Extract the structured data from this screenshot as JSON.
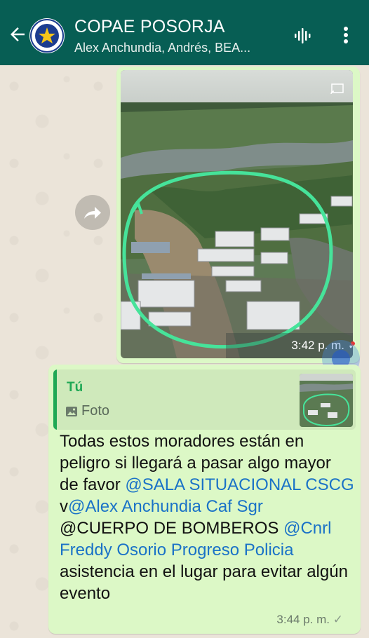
{
  "header": {
    "title": "COPAE POSORJA",
    "subtitle": "Alex Anchundia, Andrés, BEA...",
    "bg_color": "#075e54"
  },
  "image_message": {
    "time": "3:42 p. m.",
    "tick": "✓",
    "photo_description_icon": "cast-icon"
  },
  "text_message": {
    "quote": {
      "author": "Tú",
      "label": "Foto"
    },
    "segments": [
      {
        "text": "Todas estos moradores están en peligro si llegará a pasar algo mayor de favor ",
        "mention": false
      },
      {
        "text": "@SALA SITUACIONAL CSCG",
        "mention": true
      },
      {
        "text": " v",
        "mention": false
      },
      {
        "text": "@Alex Anchundia Caf Sgr",
        "mention": true
      },
      {
        "text": " @CUERPO DE BOMBEROS ",
        "mention": false
      },
      {
        "text": "@Cnrl Freddy Osorio Progreso Policia",
        "mention": true
      },
      {
        "text": " asistencia en el lugar para evitar algún evento",
        "mention": false
      }
    ],
    "time": "3:44 p. m.",
    "tick": "✓"
  },
  "colors": {
    "bubble": "#dcf8c6",
    "mention": "#1a72c7",
    "quote_accent": "#1fa855"
  }
}
